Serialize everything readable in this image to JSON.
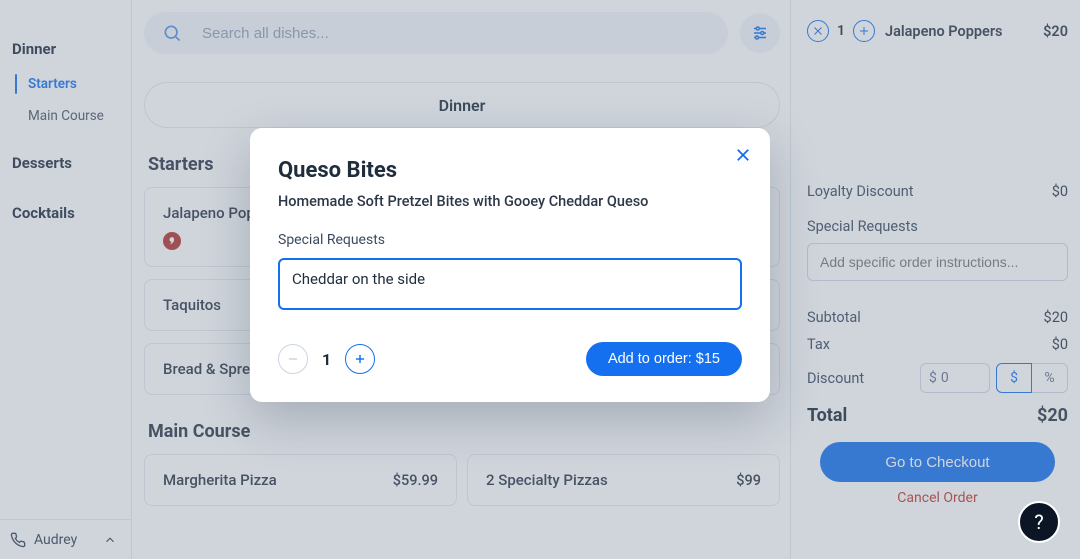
{
  "sidebar": {
    "sections": [
      {
        "title": "Dinner",
        "items": [
          "Starters",
          "Main Course"
        ],
        "activeIndex": 0
      },
      {
        "title": "Desserts",
        "items": []
      },
      {
        "title": "Cocktails",
        "items": []
      }
    ],
    "voice_name": "Audrey"
  },
  "search": {
    "placeholder": "Search all dishes..."
  },
  "menu_tab_label": "Dinner",
  "sections": [
    {
      "title": "Starters",
      "dishes": [
        {
          "name": "Jalapeno Poppers",
          "price": "",
          "spicy": true
        },
        {
          "name": "Taquitos",
          "price": ""
        },
        {
          "name": "Bread & Spreads",
          "price": ""
        }
      ]
    },
    {
      "title": "Main Course",
      "dishes_row": [
        {
          "name": "Margherita Pizza",
          "price": "$59.99"
        },
        {
          "name": "2 Specialty Pizzas",
          "price": "$99"
        }
      ]
    }
  ],
  "order": {
    "items": [
      {
        "qty": "1",
        "name": "Jalapeno Poppers",
        "price": "$20"
      }
    ],
    "loyalty_label": "Loyalty Discount",
    "loyalty_value": "$0",
    "special_label": "Special Requests",
    "special_placeholder": "Add specific order instructions...",
    "subtotal_label": "Subtotal",
    "subtotal_value": "$20",
    "tax_label": "Tax",
    "tax_value": "$0",
    "discount_label": "Discount",
    "discount_prefix": "$",
    "discount_value": "0",
    "discount_mode_currency": "$",
    "discount_mode_percent": "%",
    "total_label": "Total",
    "total_value": "$20",
    "checkout_label": "Go to Checkout",
    "cancel_label": "Cancel Order"
  },
  "modal": {
    "title": "Queso Bites",
    "desc": "Homemade Soft Pretzel Bites with Gooey Cheddar Queso",
    "special_label": "Special Requests",
    "special_value": "Cheddar on the side",
    "qty": "1",
    "add_label": "Add to order: $15"
  },
  "help_glyph": "?"
}
